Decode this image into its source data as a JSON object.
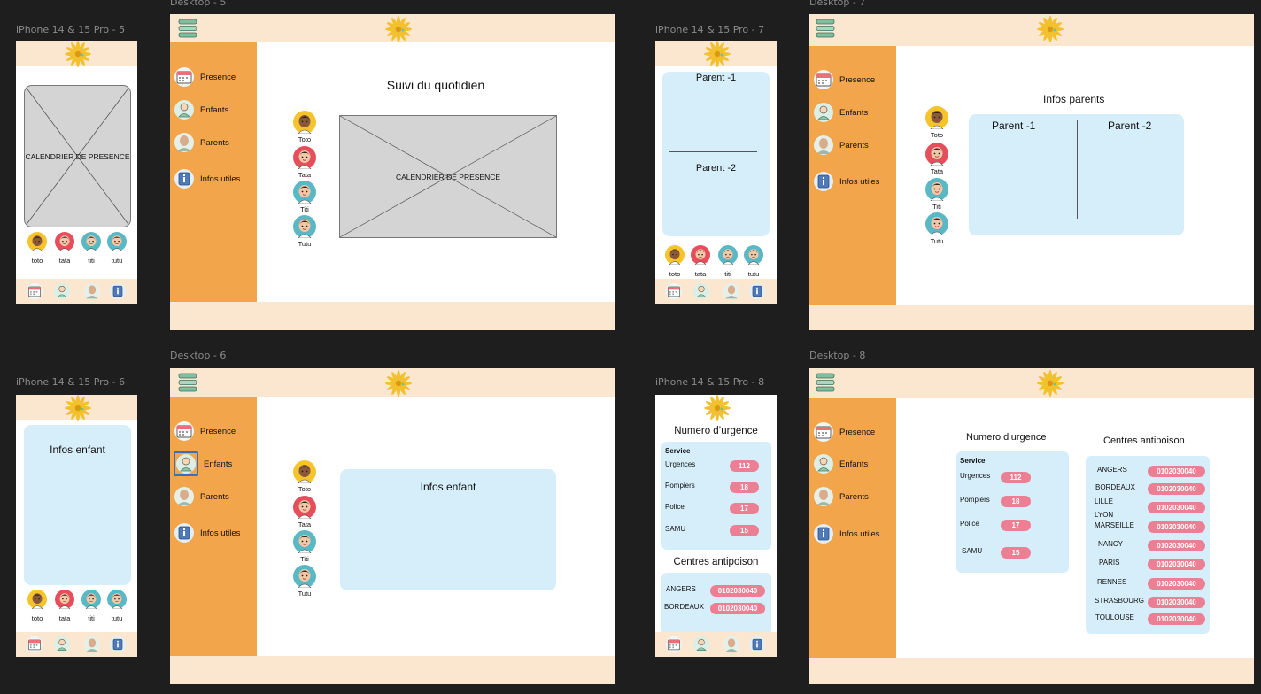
{
  "frames": {
    "m5": "iPhone 14 & 15 Pro - 5",
    "d5": "Desktop - 5",
    "m7": "iPhone 14 & 15 Pro - 7",
    "d7": "Desktop - 7",
    "m6": "iPhone 14 & 15 Pro - 6",
    "d6": "Desktop - 6",
    "m8": "iPhone 14 & 15 Pro - 8",
    "d8": "Desktop - 8"
  },
  "menu": [
    "Presence",
    "Enfants",
    "Parents",
    "Infos utiles"
  ],
  "kids_cap": [
    "Toto",
    "Tata",
    "Titi",
    "Tutu"
  ],
  "kids_lower": [
    "toto",
    "tata",
    "titi",
    "tutu"
  ],
  "calendar_label": "CALENDRIER DE PRESENCE",
  "suivi_title": "Suivi du quotidien",
  "infos_enfant": "Infos enfant",
  "infos_parents": "Infos parents",
  "parent1": "Parent -1",
  "parent2": "Parent -2",
  "urgence_title": "Numero d’urgence",
  "service_header": "Service",
  "services": [
    {
      "name": "Urgences",
      "num": "112"
    },
    {
      "name": "Pompiers",
      "num": "18"
    },
    {
      "name": "Police",
      "num": "17"
    },
    {
      "name": "SAMU",
      "num": "15"
    }
  ],
  "antipoison_title": "Centres antipoison",
  "cities": [
    "ANGERS",
    "BORDEAUX",
    "LILLE",
    "LYON",
    "MARSEILLE",
    "NANCY",
    "PARIS",
    "RENNES",
    "STRASBOURG",
    "TOULOUSE"
  ],
  "phone": "0102030040",
  "colors": {
    "canvas": "#1e1e1e",
    "band": "#fbe7cf",
    "sidebar": "#f2a54a",
    "panel": "#d6eefa",
    "pill": "#ec7f93",
    "placeholder": "#d4d4d4"
  },
  "icons": [
    "menu-icon",
    "flower-logo-icon",
    "calendar-icon",
    "child-icon",
    "parent-icon",
    "info-icon"
  ]
}
